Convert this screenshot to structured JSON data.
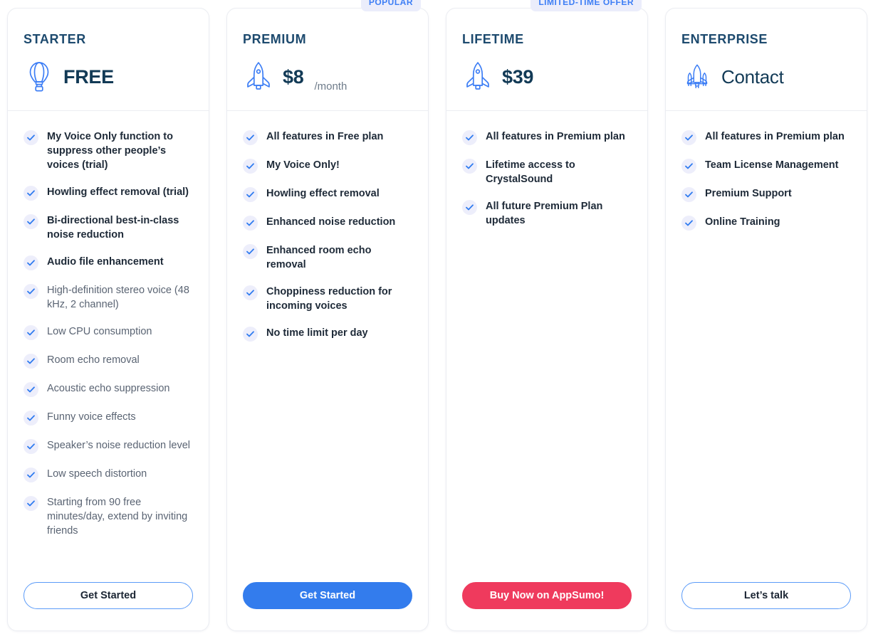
{
  "accent_colors": {
    "brand_blue": "#337ced",
    "dark_navy": "#123a56",
    "badge_bg": "#ebedfb",
    "badge_text": "#3d7ef5",
    "danger_red": "#ef3a5d",
    "check_circle_bg": "#edeefb",
    "check_mark": "#2f7bf0",
    "card_border": "#ebedf2",
    "muted_text": "#5a6473"
  },
  "plans": [
    {
      "id": "starter",
      "name": "STARTER",
      "icon": "hot-air-balloon-icon",
      "price": "FREE",
      "period": "",
      "badge": null,
      "features": [
        {
          "text": "My Voice Only function to suppress other people’s voices (trial)",
          "emphasis": true
        },
        {
          "text": "Howling effect removal (trial)",
          "emphasis": true
        },
        {
          "text": "Bi-directional best-in-class noise reduction",
          "emphasis": true
        },
        {
          "text": "Audio file enhancement",
          "emphasis": true
        },
        {
          "text": "High-definition stereo voice (48 kHz, 2 channel)",
          "emphasis": false
        },
        {
          "text": "Low CPU consumption",
          "emphasis": false
        },
        {
          "text": "Room echo removal",
          "emphasis": false
        },
        {
          "text": "Acoustic echo suppression",
          "emphasis": false
        },
        {
          "text": "Funny voice effects",
          "emphasis": false
        },
        {
          "text": "Speaker’s noise reduction level",
          "emphasis": false
        },
        {
          "text": "Low speech distortion",
          "emphasis": false
        },
        {
          "text": "Starting from 90 free minutes/day, extend by inviting friends",
          "emphasis": false
        }
      ],
      "cta": {
        "label": "Get Started",
        "style": "outline"
      }
    },
    {
      "id": "premium",
      "name": "PREMIUM",
      "icon": "rocket-icon",
      "price": "$8",
      "period": "/month",
      "badge": "POPULAR",
      "features": [
        {
          "text": "All features in Free plan",
          "emphasis": true
        },
        {
          "text": "My Voice Only!",
          "emphasis": true
        },
        {
          "text": "Howling effect removal",
          "emphasis": true
        },
        {
          "text": "Enhanced noise reduction",
          "emphasis": true
        },
        {
          "text": "Enhanced room echo removal",
          "emphasis": true
        },
        {
          "text": "Choppiness reduction for incoming voices",
          "emphasis": true
        },
        {
          "text": "No time limit per day",
          "emphasis": true
        }
      ],
      "cta": {
        "label": "Get Started",
        "style": "primary"
      }
    },
    {
      "id": "lifetime",
      "name": "LIFETIME",
      "icon": "rocket-icon",
      "price": "$39",
      "period": "",
      "badge": "LIMITED-TIME OFFER",
      "features": [
        {
          "text": "All features in Premium plan",
          "emphasis": true
        },
        {
          "text": "Lifetime access to CrystalSound",
          "emphasis": true
        },
        {
          "text": "All future Premium Plan updates",
          "emphasis": true
        }
      ],
      "cta": {
        "label": "Buy Now on AppSumo!",
        "style": "danger"
      }
    },
    {
      "id": "enterprise",
      "name": "ENTERPRISE",
      "icon": "space-shuttle-icon",
      "price": "Contact",
      "period": "",
      "badge": null,
      "features": [
        {
          "text": "All features in Premium plan",
          "emphasis": true
        },
        {
          "text": "Team License Management",
          "emphasis": true
        },
        {
          "text": "Premium Support",
          "emphasis": true
        },
        {
          "text": "Online Training",
          "emphasis": true
        }
      ],
      "cta": {
        "label": "Let’s talk",
        "style": "outline"
      }
    }
  ]
}
